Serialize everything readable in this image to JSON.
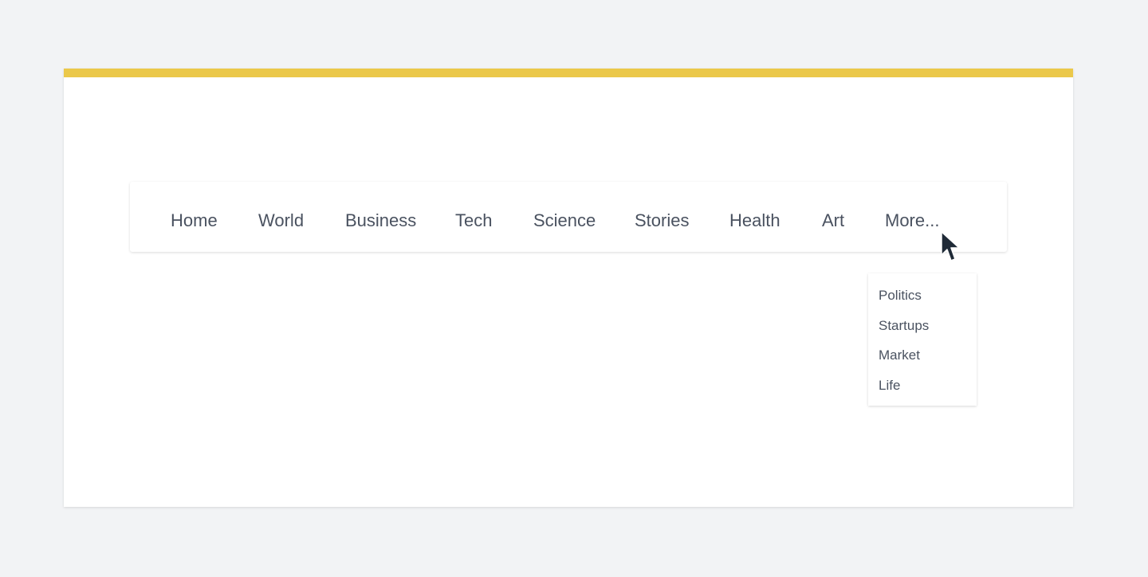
{
  "colors": {
    "accent": "#ebc84a",
    "page_background": "#f2f3f5",
    "card_background": "#ffffff",
    "text": "#4a5260",
    "cursor": "#1f2a37"
  },
  "nav": {
    "items": [
      {
        "label": "Home"
      },
      {
        "label": "World"
      },
      {
        "label": "Business"
      },
      {
        "label": "Tech"
      },
      {
        "label": "Science"
      },
      {
        "label": "Stories"
      },
      {
        "label": "Health"
      },
      {
        "label": "Art"
      },
      {
        "label": "More..."
      }
    ]
  },
  "dropdown": {
    "items": [
      {
        "label": "Politics"
      },
      {
        "label": "Startups"
      },
      {
        "label": "Market"
      },
      {
        "label": "Life"
      }
    ]
  },
  "cursor": {
    "icon": "mouse-pointer-icon"
  }
}
